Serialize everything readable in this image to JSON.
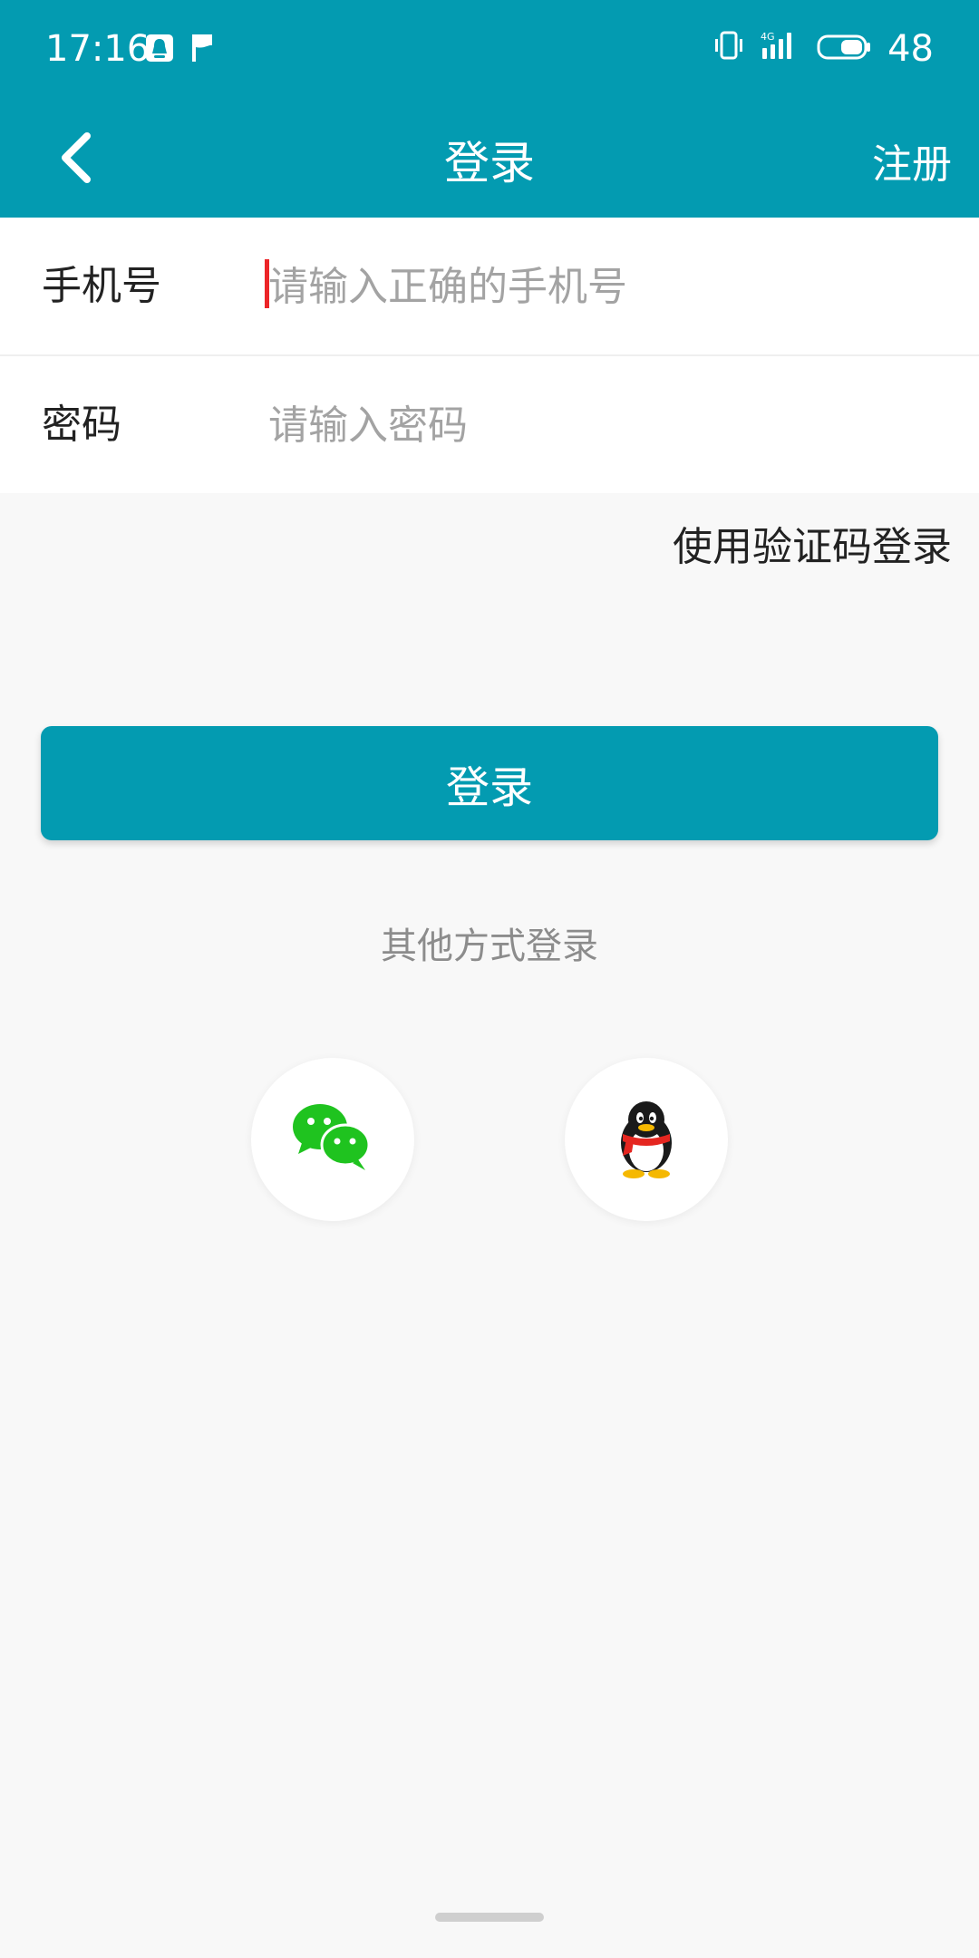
{
  "status_bar": {
    "time": "17:16",
    "left_icons": [
      "qq-notification-icon",
      "flag-icon"
    ],
    "right_icons": [
      "vibrate-icon",
      "signal-4g-icon",
      "battery-icon"
    ],
    "battery_text": "48"
  },
  "nav": {
    "title": "登录",
    "register_label": "注册",
    "back_icon": "chevron-left-icon"
  },
  "form": {
    "phone_label": "手机号",
    "phone_placeholder": "请输入正确的手机号",
    "phone_value": "",
    "password_label": "密码",
    "password_placeholder": "请输入密码",
    "password_value": ""
  },
  "sms_login_label": "使用验证码登录",
  "login_button_label": "登录",
  "other_methods_label": "其他方式登录",
  "social": [
    {
      "name": "wechat",
      "icon": "wechat-icon"
    },
    {
      "name": "qq",
      "icon": "qq-penguin-icon"
    }
  ],
  "colors": {
    "primary": "#039bb1",
    "background": "#f8f8f8",
    "caret": "#ec2528",
    "wechat_green": "#1fc31f"
  }
}
